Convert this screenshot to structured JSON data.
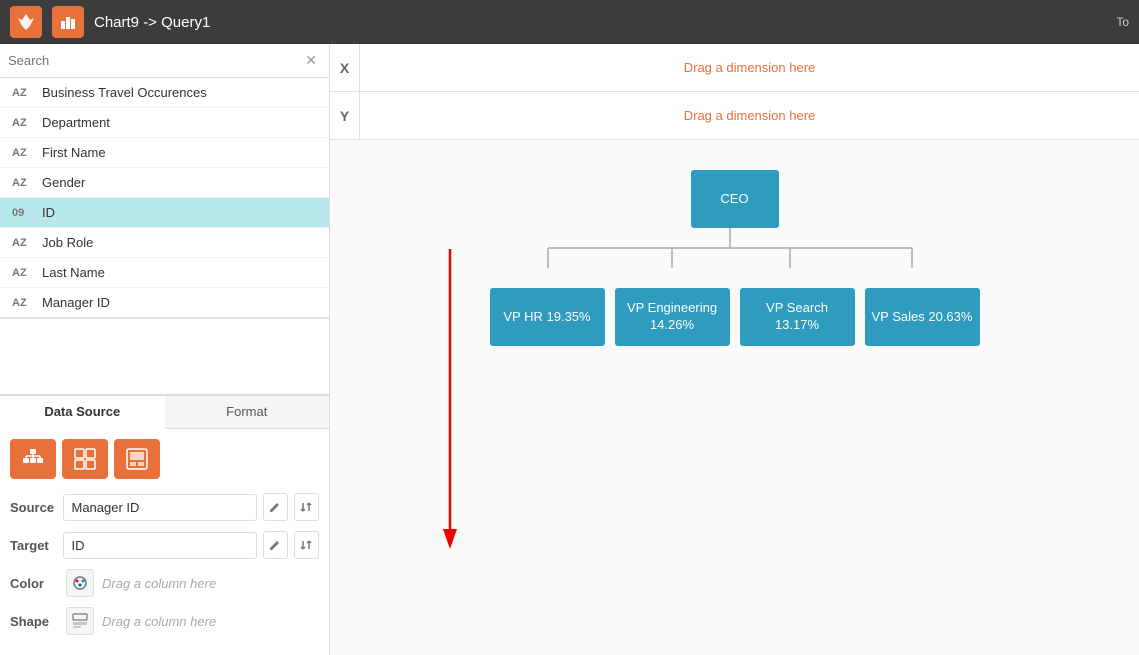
{
  "header": {
    "title": "Chart9 -> Query1",
    "right_text": "To",
    "flame_icon": "✦",
    "chart_icon": "📊"
  },
  "search": {
    "placeholder": "Search",
    "close_icon": "✕"
  },
  "fields": [
    {
      "type": "AZ",
      "name": "Business Travel Occurences"
    },
    {
      "type": "AZ",
      "name": "Department"
    },
    {
      "type": "AZ",
      "name": "First Name"
    },
    {
      "type": "AZ",
      "name": "Gender"
    },
    {
      "type": "09",
      "name": "ID",
      "active": true
    },
    {
      "type": "AZ",
      "name": "Job Role"
    },
    {
      "type": "AZ",
      "name": "Last Name"
    },
    {
      "type": "AZ",
      "name": "Manager ID"
    }
  ],
  "bottom_panel": {
    "tab_datasource": "Data Source",
    "tab_format": "Format"
  },
  "chart_icons": [
    {
      "icon": "⊞",
      "title": "org-chart"
    },
    {
      "icon": "⊟",
      "title": "treemap"
    },
    {
      "icon": "◫",
      "title": "other"
    }
  ],
  "source_row": {
    "label": "Source",
    "value": "Manager ID",
    "edit_icon": "✎",
    "sort_icon": "↕"
  },
  "target_row": {
    "label": "Target",
    "value": "ID",
    "edit_icon": "✎",
    "sort_icon": "↕"
  },
  "color_row": {
    "label": "Color",
    "icon": "🎨",
    "placeholder": "Drag a column here"
  },
  "shape_row": {
    "label": "Shape",
    "icon": "▤",
    "placeholder": "Drag a column here"
  },
  "chart": {
    "x_label": "X",
    "y_label": "Y",
    "x_placeholder": "Drag a dimension here",
    "y_placeholder": "Drag a dimension here",
    "ceo_label": "CEO",
    "vp_nodes": [
      {
        "label": "VP HR 19.35%"
      },
      {
        "label": "VP Engineering 14.26%"
      },
      {
        "label": "VP Search 13.17%"
      },
      {
        "label": "VP Sales 20.63%"
      }
    ]
  }
}
